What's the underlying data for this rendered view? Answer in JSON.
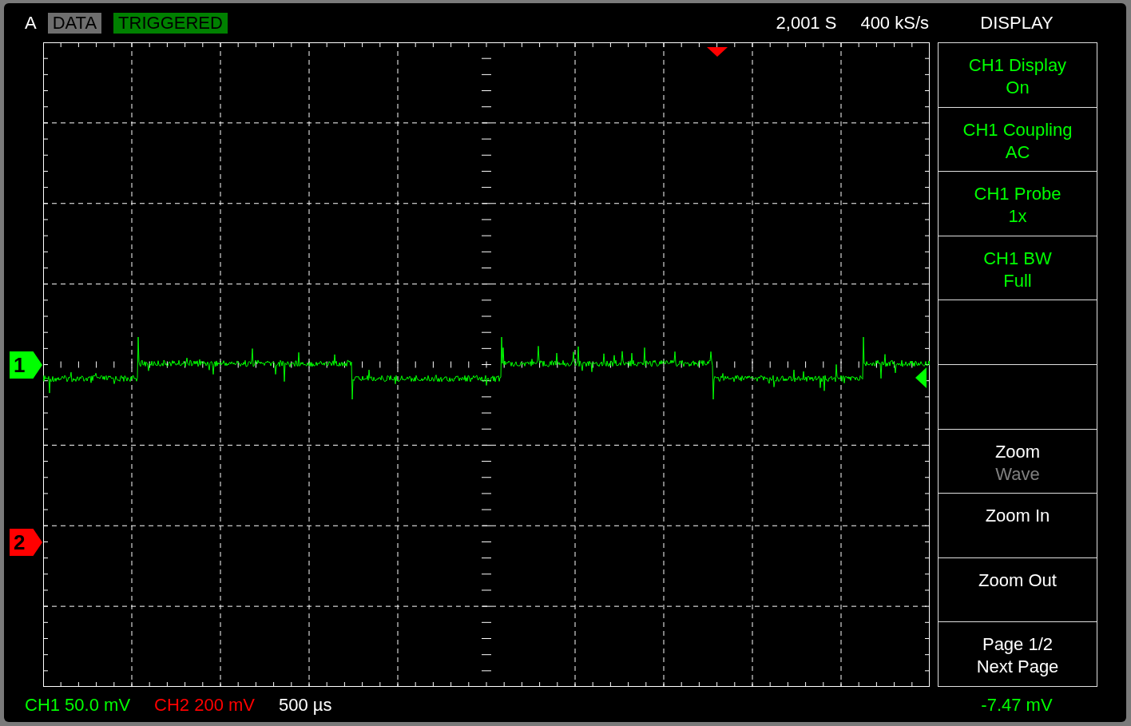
{
  "header": {
    "channel": "A",
    "mode": "DATA",
    "status": "TRIGGERED",
    "record_length": "2,001 S",
    "sample_rate": "400 kS/s"
  },
  "menu": {
    "title": "DISPLAY",
    "items": [
      {
        "kind": "setting",
        "title": "CH1 Display",
        "value": "On",
        "color": "#00ff00"
      },
      {
        "kind": "setting",
        "title": "CH1 Coupling",
        "value": "AC",
        "color": "#00ff00"
      },
      {
        "kind": "setting",
        "title": "CH1 Probe",
        "value": "1x",
        "color": "#00ff00"
      },
      {
        "kind": "setting",
        "title": "CH1 BW",
        "value": "Full",
        "color": "#00ff00"
      },
      {
        "kind": "empty"
      },
      {
        "kind": "empty"
      },
      {
        "kind": "action",
        "title": "Zoom",
        "value": "Wave",
        "disabled": true,
        "color": "#ffffff"
      },
      {
        "kind": "action",
        "title": "Zoom In",
        "color": "#ffffff"
      },
      {
        "kind": "action",
        "title": "Zoom Out",
        "color": "#ffffff"
      },
      {
        "kind": "action",
        "title": "Page 1/2",
        "value": "Next Page",
        "color": "#ffffff"
      }
    ]
  },
  "channel_markers": [
    {
      "label": "1",
      "color": "#00ff00"
    },
    {
      "label": "2",
      "color": "#ff0000"
    }
  ],
  "footer": {
    "scales": [
      {
        "text": "CH1 50.0 mV",
        "color": "#00ff00"
      },
      {
        "text": "CH2 200 mV",
        "color": "#ff0000"
      },
      {
        "text": "500 µs",
        "color": "#ffffff"
      }
    ],
    "readout": "-7.47 mV"
  }
}
